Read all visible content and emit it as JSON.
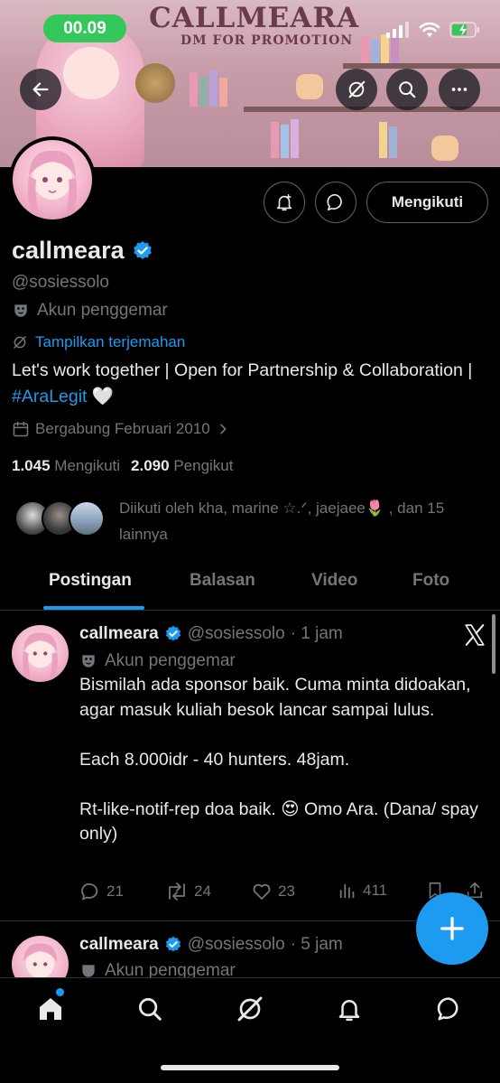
{
  "status_bar": {
    "time": "00.09"
  },
  "banner": {
    "title": "CALLMEARA",
    "subtitle": "DM FOR PROMOTION"
  },
  "header": {
    "follow_button": "Mengikuti"
  },
  "profile": {
    "name": "callmeara",
    "handle": "@sosiessolo",
    "fan_label": "Akun penggemar",
    "translate_label": "Tampilkan terjemahan",
    "bio_prefix": "Let's work together | Open for Partnership & Collaboration | ",
    "bio_hashtag": "#AraLegit",
    "bio_suffix": " 🤍",
    "joined": "Bergabung Februari 2010",
    "following_count": "1.045",
    "following_label": "Mengikuti",
    "followers_count": "2.090",
    "followers_label": "Pengikut",
    "followed_by": "Diikuti oleh kha, marine ☆.ᐟ, jaejaee🌷 , dan 15 lainnya"
  },
  "tabs": [
    {
      "label": "Postingan",
      "active": true
    },
    {
      "label": "Balasan",
      "active": false
    },
    {
      "label": "Video",
      "active": false
    },
    {
      "label": "Foto",
      "active": false
    }
  ],
  "posts": [
    {
      "name": "callmeara",
      "handle": "@sosiessolo",
      "time": "· 1 jam",
      "fan_label": "Akun penggemar",
      "text": "Bismilah ada sponsor baik. Cuma minta didoakan, agar masuk kuliah besok lancar sampai lulus.\n\nEach 8.000idr - 40 hunters. 48jam.\n\nRt-like-notif-rep doa baik. 😍 Omo Ara. (Dana/ spay only)",
      "replies": "21",
      "reposts": "24",
      "likes": "23",
      "views": "411"
    },
    {
      "name": "callmeara",
      "handle": "@sosiessolo",
      "time": "· 5 jam",
      "fan_label": "Akun penggemar"
    }
  ],
  "colors": {
    "accent": "#1d9bf0",
    "muted": "#71767b",
    "background": "#000000",
    "status_green": "#34c759"
  }
}
